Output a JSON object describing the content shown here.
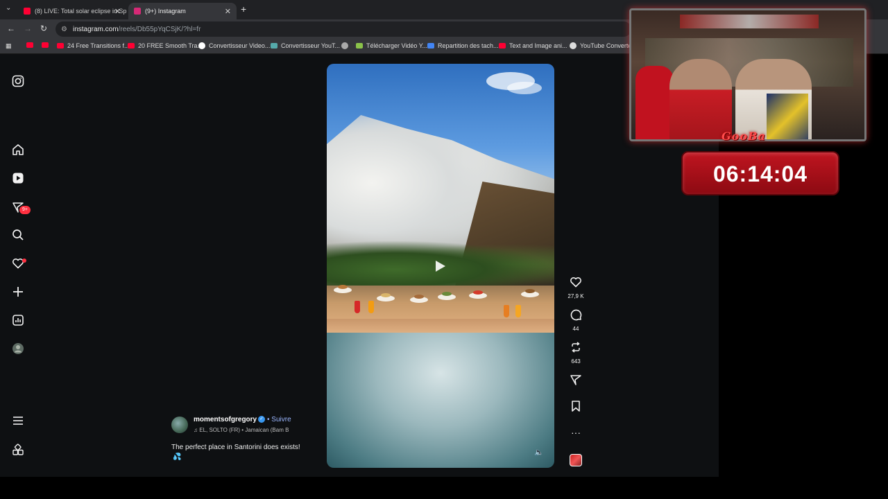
{
  "browser": {
    "tabs": [
      {
        "title": "(8) LIVE: Total solar eclipse in Sp",
        "favicon_color": "#ff0033"
      },
      {
        "title": "(9+) Instagram",
        "favicon_color": "#d62976"
      }
    ],
    "url_host": "instagram.com",
    "url_path": "/reels/Db55pYqCSjK/?hl=fr",
    "bookmarks": [
      {
        "label": "",
        "icon_color": "#ff0033"
      },
      {
        "label": "",
        "icon_color": "#ff0033"
      },
      {
        "label": "24 Free Transitions f...",
        "icon_color": "#ff0033"
      },
      {
        "label": "20 FREE Smooth Tra...",
        "icon_color": "#ff0033"
      },
      {
        "label": "Convertisseur Video...",
        "icon_color": "#ffffff"
      },
      {
        "label": "Convertisseur YouT...",
        "icon_color": "#5aa"
      },
      {
        "label": "",
        "icon_color": "#aaa"
      },
      {
        "label": "Télécharger Vidéo Y...",
        "icon_color": "#8bc34a"
      },
      {
        "label": "Repartition des tach...",
        "icon_color": "#4285f4"
      },
      {
        "label": "Text and Image ani...",
        "icon_color": "#ff0033"
      },
      {
        "label": "YouTube Converter",
        "icon_color": "#ddd"
      }
    ]
  },
  "sidebar": {
    "notif_badge": "9+",
    "icons": [
      "instagram-icon",
      "home-icon",
      "reels-icon",
      "messages-icon",
      "search-icon",
      "heart-icon",
      "create-icon",
      "dashboard-icon",
      "profile-icon",
      "menu-icon",
      "apps-icon"
    ]
  },
  "reel": {
    "username": "momentsofgregory",
    "follow_label": "Suivre",
    "music": "EL, SOLTO (FR) • Jamaican (Bam B",
    "caption": "The perfect place in Santorini does exists!",
    "caption_emoji": "💦",
    "likes": "27,9 K",
    "comments": "44",
    "reposts": "643"
  },
  "stream": {
    "logo": "GooBa",
    "timer": "06:14:04"
  },
  "colors": {
    "badge": "#ff3040",
    "follow": "#9bb7ff",
    "timer_bg": "#c01520"
  }
}
